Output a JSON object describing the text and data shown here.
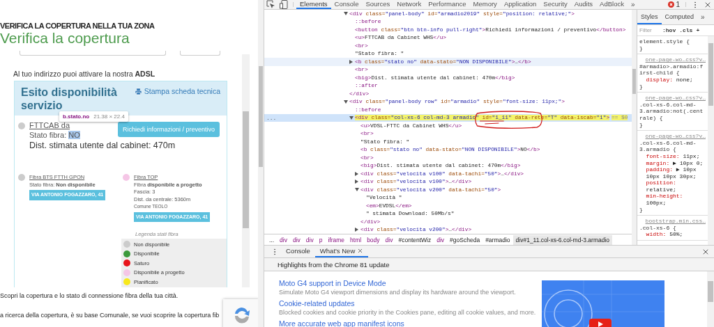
{
  "page": {
    "eyebrow": "VERIFICA LA COPERTURA NELLA TUA ZONA",
    "title": "Verifica la copertura",
    "frame": {
      "intro": "Al tuo indirizzo puoi attivare la nostra **ADSL**",
      "result_panel": {
        "title": "Esito disponibilità servizio",
        "print_link": "Stampa scheda tecnica",
        "main_item": {
          "title": "FTTCAB da",
          "color": "#cccccc",
          "status_label": "Stato fibra:",
          "status": "NO",
          "status_highlighted": true,
          "distance": "Dist. stimata utente dal cabinet: 470m",
          "button": "Richiedi informazioni / preventivo"
        },
        "tooltip": {
          "selector": "b.stato.no",
          "size": "21.38 × 22.4"
        },
        "fiber_items": [
          {
            "title": "Fibra BTS FTTH GPON",
            "color": "#cccccc",
            "lines": [
              {
                "kind": "line",
                "text": "Stato fibra: **Non disponibile**"
              }
            ],
            "address": "VIA ANTONIO FOGAZZARO, 41"
          },
          {
            "title": "Fibra TOP",
            "color": "#f5c6e6",
            "lines": [
              {
                "kind": "line",
                "text": "Fibra **disponibile a progetto**"
              },
              {
                "kind": "line",
                "text": "Fascia: 3"
              },
              {
                "kind": "line",
                "text": "Dist. da centrale: 5360m"
              },
              {
                "kind": "note",
                "text": "Comune TEOLO"
              }
            ],
            "address": "VIA ANTONIO FOGAZZARO, 41"
          }
        ],
        "legend": {
          "title": "Legenda stati fibra",
          "items": [
            {
              "label": "Non disponibile",
              "color": "#cccccc"
            },
            {
              "label": "Disponibile",
              "color": "#3c9a3c"
            },
            {
              "label": "Saturo",
              "color": "#e8141b"
            },
            {
              "label": "Disponibile a progetto",
              "color": "#f5c6e6"
            },
            {
              "label": "Pianificato",
              "color": "#f7e81b"
            }
          ]
        }
      }
    },
    "paragraphs": [
      "Scopri la copertura e lo stato di connessione fibra della tua città.",
      "a ricerca della copertura, è su base Comunale, se vuoi scoprire la copertura fib"
    ]
  },
  "devtools": {
    "tabs": [
      {
        "label": "Elements",
        "selected": true
      },
      {
        "label": "Console",
        "selected": false
      },
      {
        "label": "Sources",
        "selected": false
      },
      {
        "label": "Network",
        "selected": false
      },
      {
        "label": "Performance",
        "selected": false
      },
      {
        "label": "Memory",
        "selected": false
      },
      {
        "label": "Application",
        "selected": false
      },
      {
        "label": "Security",
        "selected": false
      },
      {
        "label": "Audits",
        "selected": false
      },
      {
        "label": "AdBlock",
        "selected": false
      }
    ],
    "more": "»",
    "error_count": "1",
    "dom_tree": [
      {
        "text": "<div class=\"panel-body\" id=\"armadio2019\" style=\"position: relative;\">",
        "expanded": true,
        "selected": false,
        "hovered": false,
        "close": "</div>",
        "children": [
          {
            "text": "::before",
            "selected": false,
            "hovered": false
          },
          {
            "text": "<button class=\"btn btn-info pull-right\">Richiedi informazioni / preventivo</button>",
            "selected": false,
            "hovered": false
          },
          {
            "text": "<u>FTTCAB da Cabinet WHS</u>",
            "selected": false,
            "hovered": false
          },
          {
            "text": "<br>",
            "selected": false,
            "hovered": false
          },
          {
            "text": "\"Stato fibra: \"",
            "selected": false,
            "hovered": false
          },
          {
            "text": "<b class=\"stato no\" data-stato=\"NON DISPONIBILE\">…</b>",
            "expanded": false,
            "selected": false,
            "hovered": true
          },
          {
            "text": "<br>",
            "selected": false,
            "hovered": false
          },
          {
            "text": "<big>Dist. stimata utente dal cabinet: 470m</big>",
            "selected": false,
            "hovered": false
          },
          {
            "text": "::after",
            "selected": false,
            "hovered": false
          }
        ]
      },
      {
        "text": "<div class=\"panel-body row\" id=\"armadio\" style=\"font-size: 11px;\">",
        "expanded": true,
        "selected": false,
        "hovered": false,
        "children": [
          {
            "text": "::before",
            "selected": false,
            "hovered": false
          },
          {
            "text": "<div class=\"col-xs-6 col-md-3 armadio\" id=\"1_11\" data-rete=\"T\" data-iscab=\"1\">",
            "suffix": "== $0",
            "gutter": "...",
            "marker_highlight": true,
            "ink_circle": true,
            "expanded": true,
            "selected": true,
            "hovered": false,
            "children": [
              {
                "text": "<u>VDSL-FTTC da Cabinet WHS</u>",
                "selected": false,
                "hovered": false
              },
              {
                "text": "<br>",
                "selected": false,
                "hovered": false
              },
              {
                "text": "\"Stato fibra: \"",
                "selected": false,
                "hovered": false
              },
              {
                "text": "<b class=\"stato no\" data-stato=\"NON DISPONIBILE\">NO</b>",
                "selected": false,
                "hovered": false
              },
              {
                "text": "<br>",
                "selected": false,
                "hovered": false
              },
              {
                "text": "<big>Dist. stimata utente dal cabinet: 470m</big>",
                "selected": false,
                "hovered": false
              },
              {
                "text": "<div class=\"velocita v100\" data-tachi=\"50\">…</div>",
                "expanded": false,
                "selected": false,
                "hovered": false
              },
              {
                "text": "<div class=\"velocita v100\">…</div>",
                "expanded": false,
                "selected": false,
                "hovered": false
              },
              {
                "text": "<div class=\"velocita v200\" data-tachi=\"50\">",
                "expanded": true,
                "selected": false,
                "hovered": false,
                "close": "</div>",
                "children": [
                  {
                    "text": "\"Velocità \"",
                    "selected": false,
                    "hovered": false
                  },
                  {
                    "text": "<em>EVDSL</em>",
                    "selected": false,
                    "hovered": false
                  },
                  {
                    "text": "\" stimata Download: 50Mb/s\"",
                    "selected": false,
                    "hovered": false
                  }
                ]
              },
              {
                "text": "<div class=\"velocita v200\">…</div>",
                "expanded": false,
                "selected": false,
                "hovered": false
              }
            ]
          }
        ]
      }
    ],
    "breadcrumbs": [
      {
        "label": "...",
        "kind": "more",
        "selected": false
      },
      {
        "label": "div",
        "kind": "tag",
        "selected": false
      },
      {
        "label": "div",
        "kind": "tag",
        "selected": false
      },
      {
        "label": "div",
        "kind": "tag",
        "selected": false
      },
      {
        "label": "p",
        "kind": "tag",
        "selected": false
      },
      {
        "label": "iframe",
        "kind": "tag",
        "selected": false
      },
      {
        "label": "html",
        "kind": "tag",
        "selected": false
      },
      {
        "label": "body",
        "kind": "tag",
        "selected": false
      },
      {
        "label": "div",
        "kind": "tag",
        "selected": false
      },
      {
        "label": "#contentWiz",
        "kind": "id",
        "selected": false
      },
      {
        "label": "div",
        "kind": "tag",
        "selected": false
      },
      {
        "label": "#goScheda",
        "kind": "id",
        "selected": false
      },
      {
        "label": "#armadio",
        "kind": "id",
        "selected": false
      },
      {
        "label": "div#1_11.col-xs-6.col-md-3.armadio",
        "kind": "id",
        "selected": true
      }
    ],
    "styles": {
      "tabs": [
        {
          "label": "Styles",
          "selected": true
        },
        {
          "label": "Computed",
          "selected": false
        }
      ],
      "more": "»",
      "filter_placeholder": "Filter",
      "hov": ":hov",
      "cls": ".cls",
      "add": "+",
      "rules": [
        {
          "selector": "element.style {",
          "close": "}"
        },
        {
          "source": "one-page-wo…css?v…",
          "selector": "#armadio>.armadio:first-child {",
          "properties": [
            {
              "name": "display:",
              "value": "none;"
            }
          ],
          "close": "}"
        },
        {
          "source": "one-page-wo…css?v…",
          "selector": ".col-xs-6.col-md-3.armadio:not(.centrale) {",
          "close": "}"
        },
        {
          "source": "one-page-wo…css?v…",
          "selector": ".col-xs-6.col-md-3.armadio {",
          "properties": [
            {
              "name": "font-size:",
              "value": "11px;"
            },
            {
              "name": "margin:",
              "value": "▶ 10px 0;"
            },
            {
              "name": "padding:",
              "value": "▶ 10px 10px 10px 30px;"
            },
            {
              "name": "position:",
              "value": "relative;"
            },
            {
              "name": "min-height:",
              "value": "100px;"
            }
          ],
          "close": "}"
        },
        {
          "source": "bootstrap.min.css…",
          "selector": ".col-xs-6 {",
          "properties": [
            {
              "name": "width:",
              "value": "50%;"
            }
          ]
        }
      ]
    },
    "drawer": {
      "tabs": [
        {
          "label": "Console",
          "selected": false,
          "closable": false
        },
        {
          "label": "What's New",
          "selected": true,
          "closable": true
        }
      ],
      "heading": "Highlights from the Chrome 81 update",
      "items": [
        {
          "title": "Moto G4 support in Device Mode",
          "description": "Simulate Moto G4 viewport dimensions and display its hardware around the viewport."
        },
        {
          "title": "Cookie-related updates",
          "description": "Blocked cookies and cookie priority in the Cookies pane, editing all cookie values, and more."
        },
        {
          "title": "More accurate web app manifest icons"
        }
      ]
    }
  }
}
